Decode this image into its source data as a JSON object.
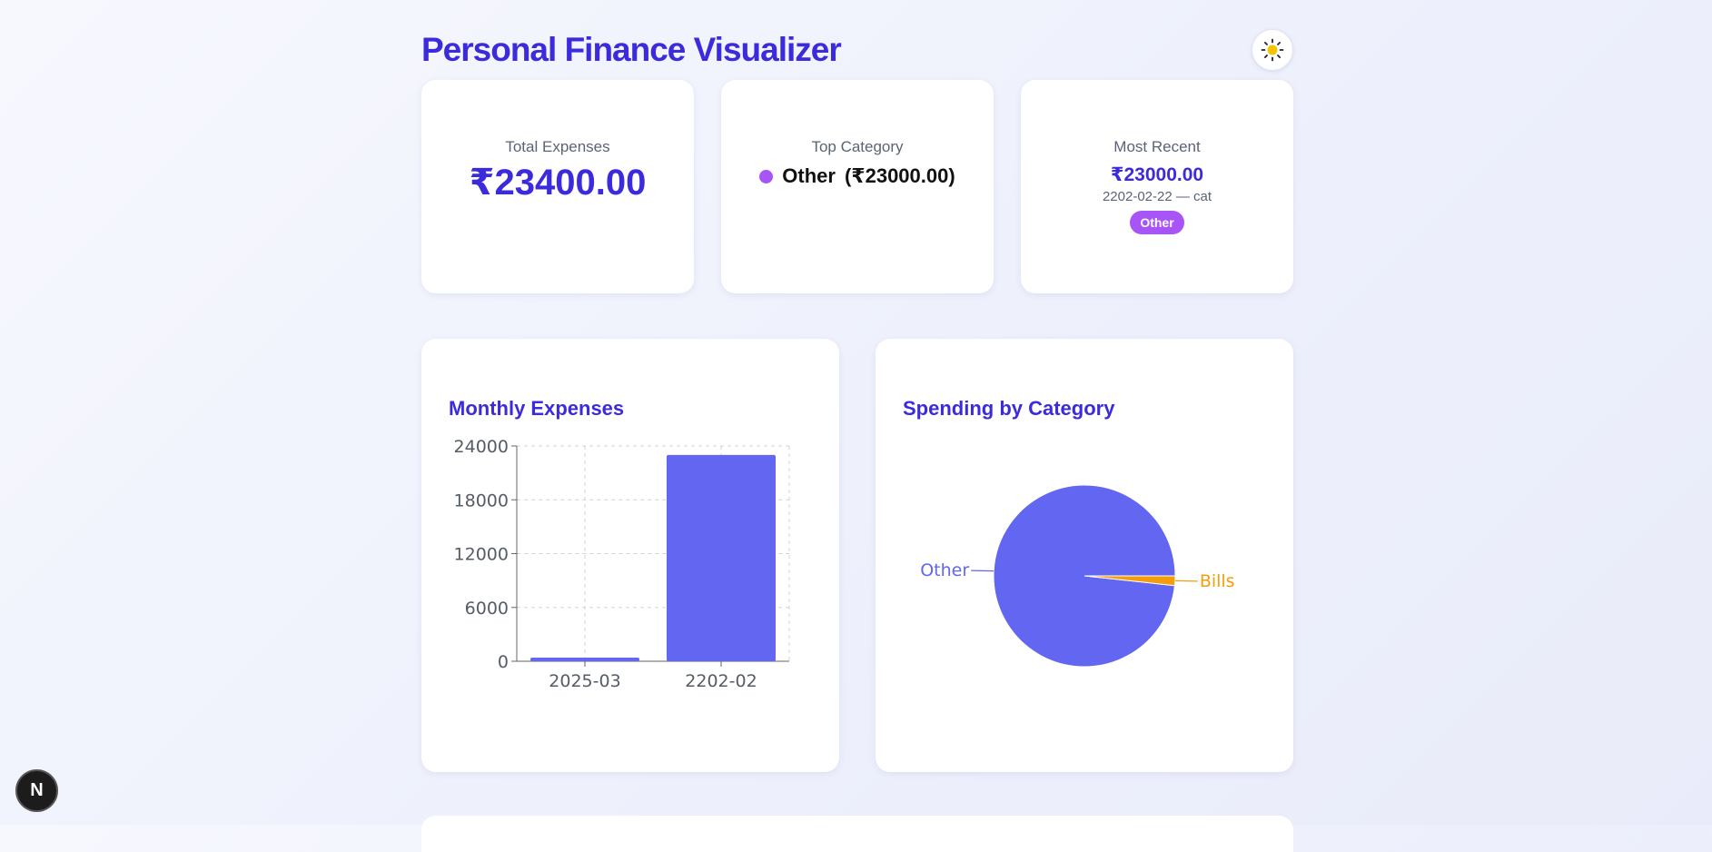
{
  "header": {
    "title": "Personal Finance Visualizer",
    "theme_icon": "sun-icon"
  },
  "summary": {
    "total": {
      "label": "Total Expenses",
      "amount": "₹23400.00"
    },
    "top_category": {
      "label": "Top Category",
      "name": "Other",
      "amount": "(₹23000.00)",
      "color": "#a855f7"
    },
    "most_recent": {
      "label": "Most Recent",
      "amount": "₹23000.00",
      "meta": "2202-02-22 — cat",
      "badge": "Other",
      "badge_color": "#a855f7"
    }
  },
  "chart_data": [
    {
      "type": "bar",
      "title": "Monthly Expenses",
      "categories": [
        "2025-03",
        "2202-02"
      ],
      "values": [
        400,
        23000
      ],
      "yticks": [
        "0",
        "6000",
        "12000",
        "18000",
        "24000"
      ],
      "ylim": [
        0,
        24000
      ],
      "grid": true,
      "color": "#6366f1"
    },
    {
      "type": "pie",
      "title": "Spending by Category",
      "labels": [
        "Other",
        "Bills"
      ],
      "values": [
        23000,
        400
      ],
      "colors": [
        "#6366f1",
        "#f59e0b"
      ]
    }
  ],
  "colors": {
    "accent": "#3b2bdc",
    "bar": "#6366f1",
    "bills": "#f59e0b",
    "badge": "#a855f7"
  },
  "dev_badge": {
    "label": "N"
  }
}
